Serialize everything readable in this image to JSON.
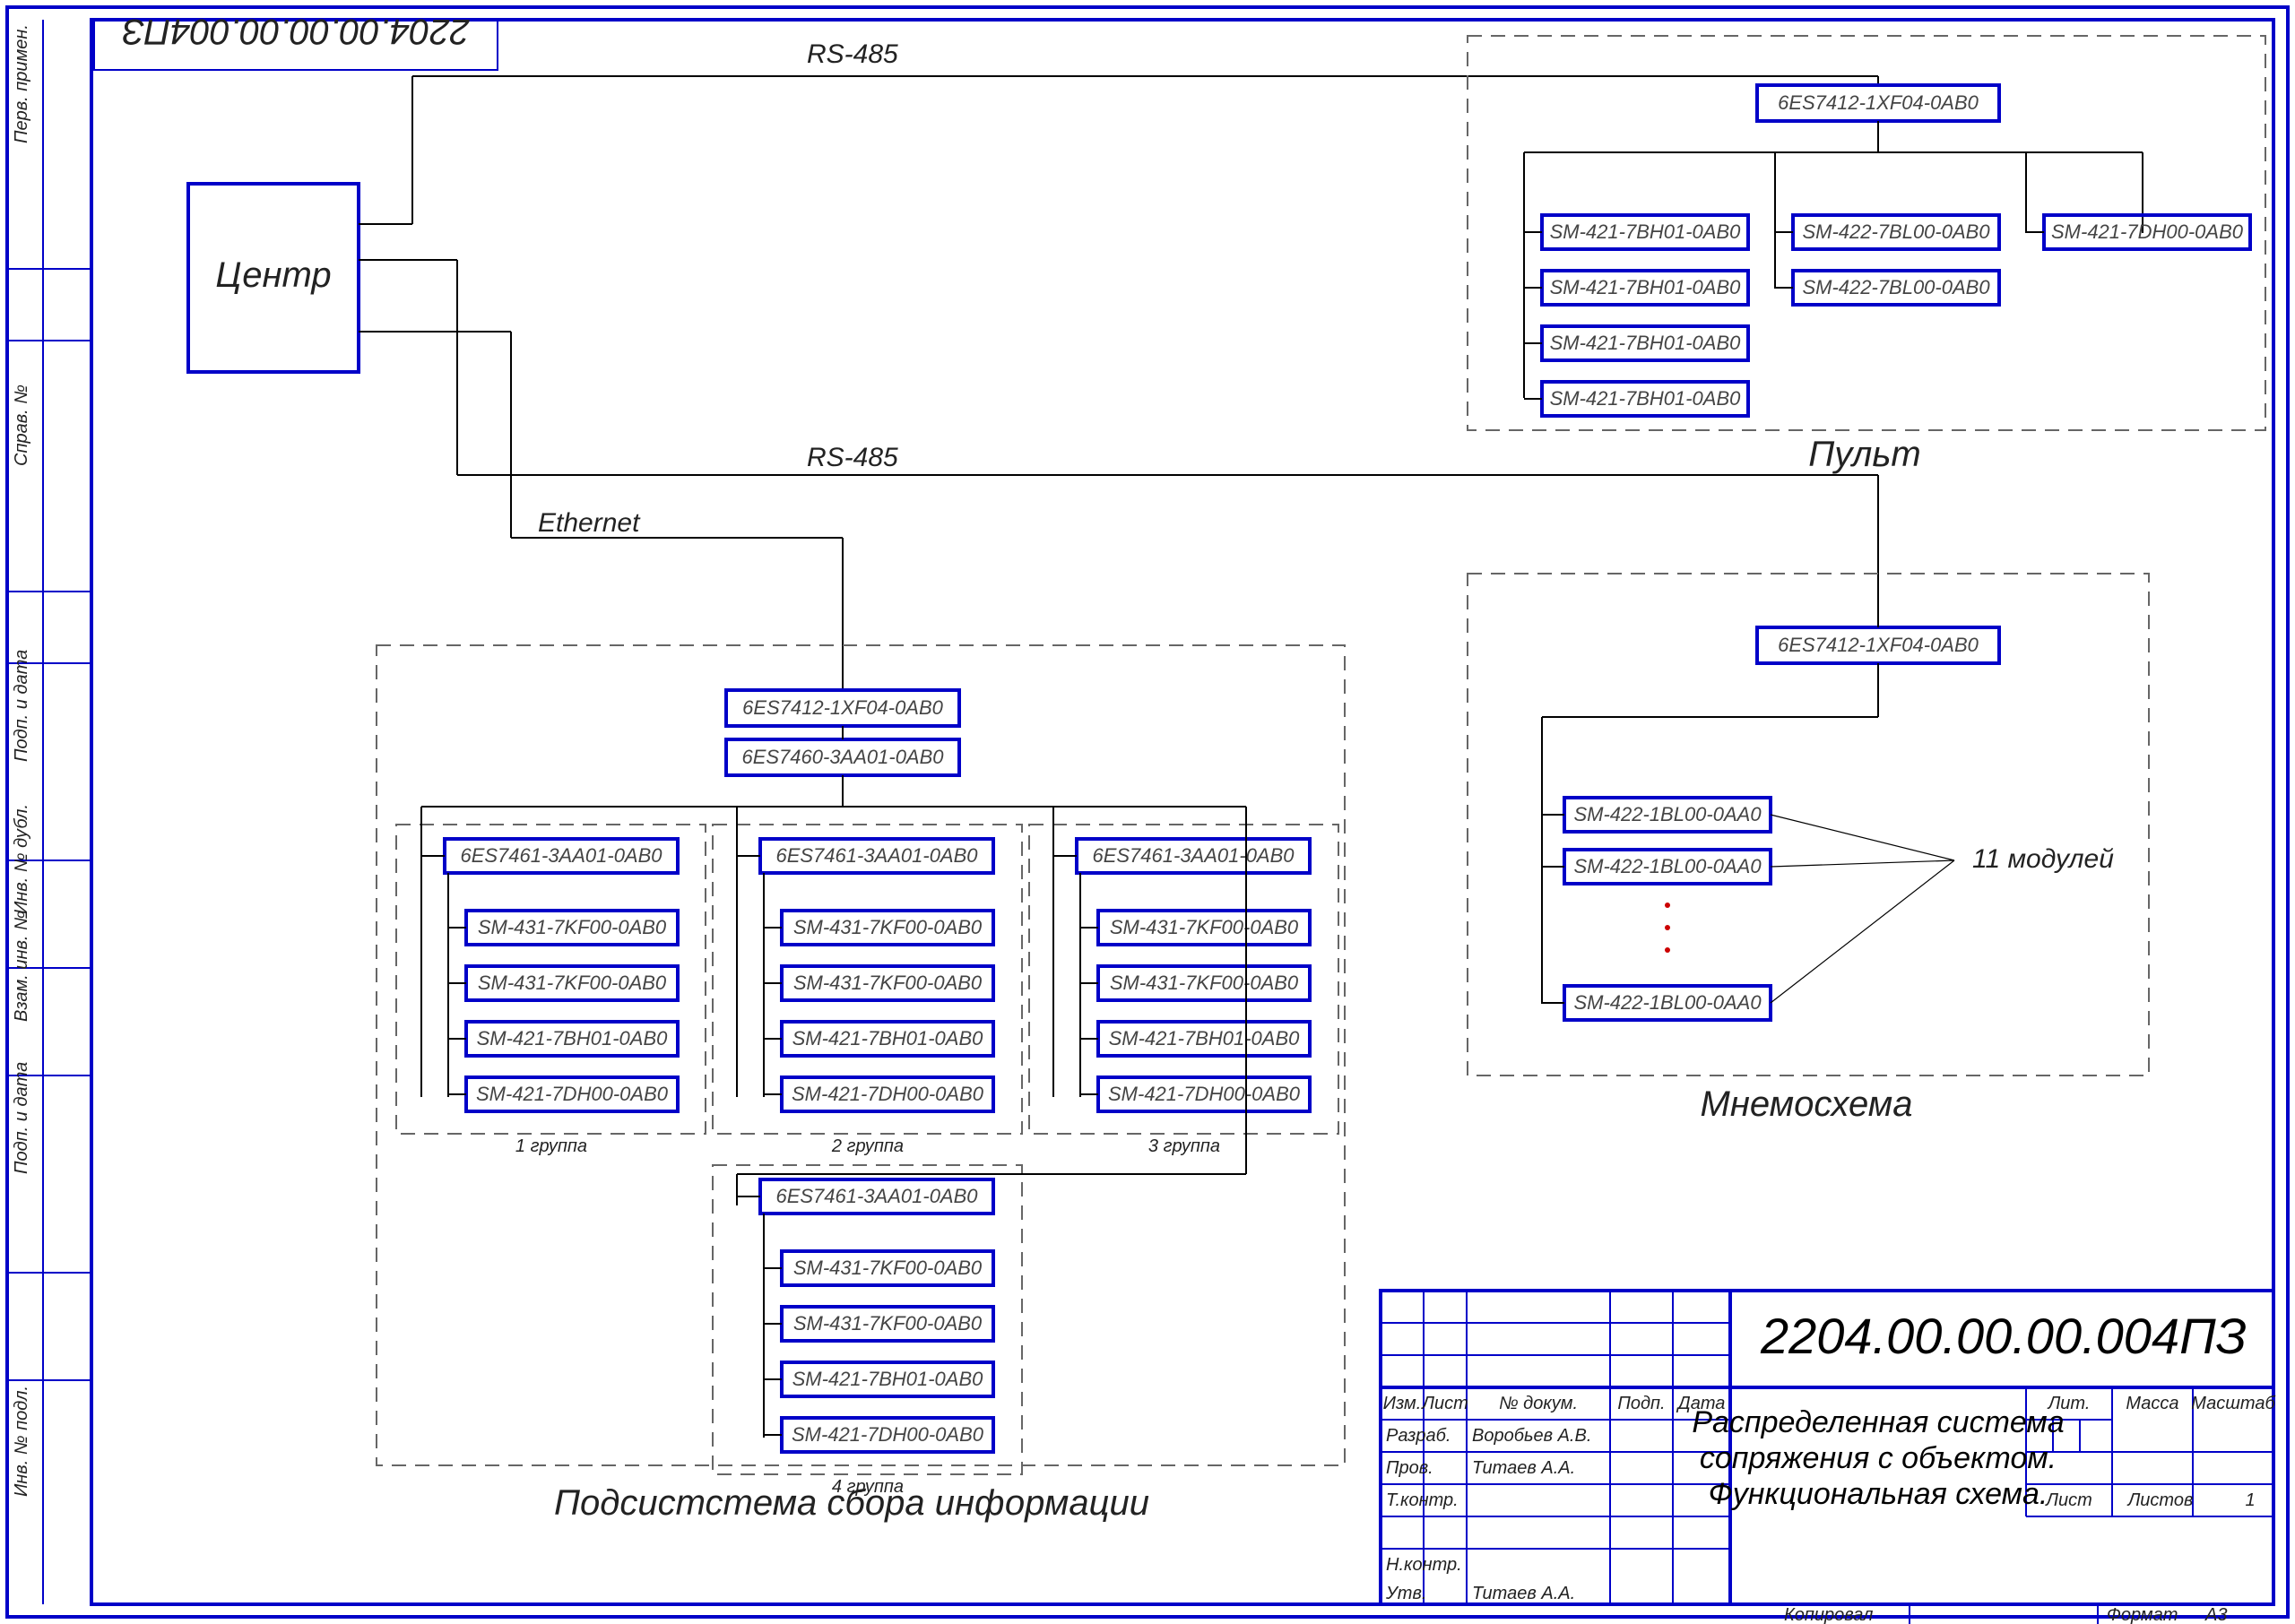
{
  "doc_number": "2204.00.00.00.004ПЗ",
  "doc_number_bottom": "2204.00.00.00.004ПЗ",
  "title1": "Распределенная система",
  "title2": "сопряжения с объектом.",
  "title3": "Функциональная схема.",
  "sidebar": {
    "f1": "Перв. примен.",
    "f2": "Справ. №",
    "f3": "Подп. и дата",
    "f4": "Инв. № дубл.",
    "f5": "Взам. инв. №",
    "f6": "Подп. и дата",
    "f7": "Инв. № подл."
  },
  "blocks": {
    "center": "Центр",
    "pult_title": "Пульт",
    "mnemo_title": "Мнемосхема",
    "subsystem_title": "Подсистстема сбора информации",
    "modules_note": "11 модулей",
    "rs485_1": "RS-485",
    "rs485_2": "RS-485",
    "ethernet": "Ethernet",
    "grp1": "1 группа",
    "grp2": "2 группа",
    "grp3": "3 группа",
    "grp4": "4 группа",
    "cpu": "6ES7412-1XF04-0AB0",
    "coupler": "6ES7460-3AA01-0AB0",
    "ext": "6ES7461-3AA01-0AB0",
    "ai": "SM-431-7KF00-0AB0",
    "di": "SM-421-7BH01-0AB0",
    "do8": "SM-421-7DH00-0AB0",
    "ao": "SM-422-7BL00-0AB0",
    "dq": "SM-422-1BL00-0AA0"
  },
  "rev": {
    "izm": "Изм.",
    "list_h": "Лист",
    "ndoc": "№ докум.",
    "podp": "Подп.",
    "data": "Дата",
    "razrab": "Разраб.",
    "razrab_name": "Воробьев А.В.",
    "prov": "Пров.",
    "prov_name": "Титаев А.А.",
    "tkontr": "Т.контр.",
    "nkontr": "Н.контр.",
    "utv": "Утв.",
    "utv_name": "Титаев А.А.",
    "lit": "Лит.",
    "massa": "Масса",
    "masht": "Масштаб",
    "list": "Лист",
    "listov": "Листов",
    "listov_n": "1",
    "kopiroval": "Копировал",
    "format": "Формат",
    "format_v": "А3"
  }
}
